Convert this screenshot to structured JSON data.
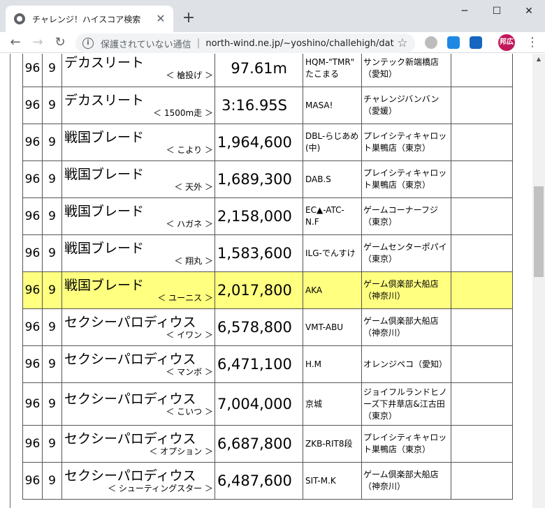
{
  "browser": {
    "tab_title": "チャレンジ！ハイスコア検索",
    "tab_close": "✕",
    "new_tab": "+",
    "security_label": "保護されていない通信",
    "url": "north-wind.ne.jp/~yoshino/challehigh/dat...",
    "profile_initials": "邦広",
    "win_minimize": "─",
    "win_maximize": "☐",
    "win_close": "✕"
  },
  "rows": [
    {
      "no": "96",
      "sub_no": "9",
      "game": "デカスリート",
      "variant": "＜ 槍投げ ＞",
      "score": "97.61m",
      "player": "HQM-\"TMR\"\nたこまる",
      "shop": "サンテック新端橋店\n（愛知）",
      "highlight": false
    },
    {
      "no": "96",
      "sub_no": "9",
      "game": "デカスリート",
      "variant": "＜ 1500m走 ＞",
      "score": "3:16.95S",
      "player": "MASA!",
      "shop": "チャレンジバンバン\n（愛媛）",
      "highlight": false
    },
    {
      "no": "96",
      "sub_no": "9",
      "game": "戦国ブレード",
      "variant": "＜ こより ＞",
      "score": "1,964,600",
      "player": "DBL-らじあめ\n(中)",
      "shop": "プレイシティキャロッ\nト巣鴨店（東京）",
      "highlight": false
    },
    {
      "no": "96",
      "sub_no": "9",
      "game": "戦国ブレード",
      "variant": "＜ 天外 ＞",
      "score": "1,689,300",
      "player": "DAB.S",
      "shop": "プレイシティキャロッ\nト巣鴨店（東京）",
      "highlight": false
    },
    {
      "no": "96",
      "sub_no": "9",
      "game": "戦国ブレード",
      "variant": "＜ ハガネ ＞",
      "score": "2,158,000",
      "player": "EC▲-ATC-\nN.F",
      "shop": "ゲームコーナーフジ\n（東京）",
      "highlight": false
    },
    {
      "no": "96",
      "sub_no": "9",
      "game": "戦国ブレード",
      "variant": "＜ 翔丸 ＞",
      "score": "1,583,600",
      "player": "ILG-でんすけ",
      "shop": "ゲームセンターポパイ\n（東京）",
      "highlight": false
    },
    {
      "no": "96",
      "sub_no": "9",
      "game": "戦国ブレード",
      "variant": "＜ ユーニス ＞",
      "score": "2,017,800",
      "player": "AKA",
      "shop": "ゲーム倶楽部大船店\n（神奈川）",
      "highlight": true
    },
    {
      "no": "96",
      "sub_no": "9",
      "game": "セクシーパロディウス",
      "variant": "＜ イワン ＞",
      "score": "6,578,800",
      "player": "VMT-ABU",
      "shop": "ゲーム倶楽部大船店\n（神奈川）",
      "highlight": false
    },
    {
      "no": "96",
      "sub_no": "9",
      "game": "セクシーパロディウス",
      "variant": "＜ マンボ ＞",
      "score": "6,471,100",
      "player": "H.M",
      "shop": "オレンジペコ（愛知）",
      "highlight": false
    },
    {
      "no": "96",
      "sub_no": "9",
      "game": "セクシーパロディウス",
      "variant": "＜ こいつ ＞",
      "score": "7,004,000",
      "player": "京城",
      "shop": "ジョイフルランドヒノ\nーズ下井草店&江古田\n（東京）",
      "highlight": false
    },
    {
      "no": "96",
      "sub_no": "9",
      "game": "セクシーパロディウス",
      "variant": "＜ オプション ＞",
      "score": "6,687,800",
      "player": "ZKB-RIT8段",
      "shop": "プレイシティキャロッ\nト巣鴨店（東京）",
      "highlight": false
    },
    {
      "no": "96",
      "sub_no": "9",
      "game": "セクシーパロディウス",
      "variant": "＜ シューティングスター ＞",
      "score": "6,487,600",
      "player": "SIT-M.K",
      "shop": "ゲーム倶楽部大船店\n（神奈川）",
      "highlight": false
    }
  ]
}
